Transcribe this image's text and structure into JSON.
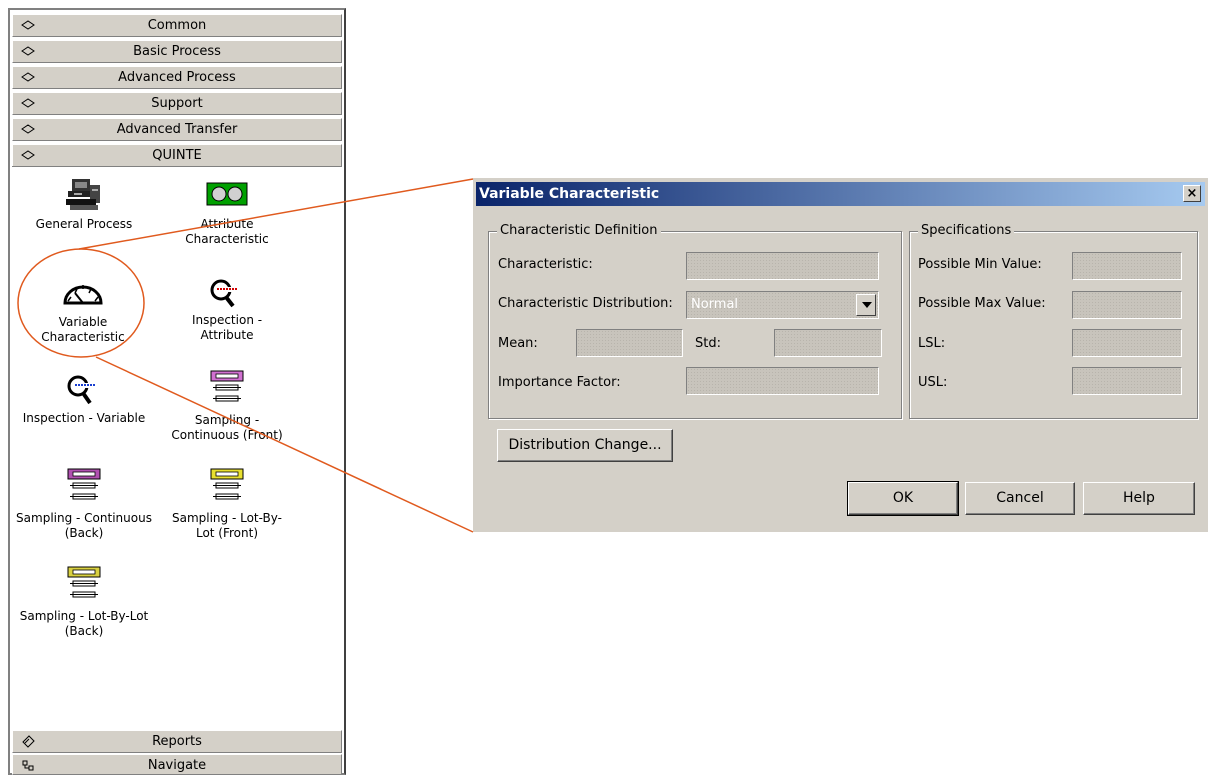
{
  "panel": {
    "top_categories": [
      {
        "label": "Common"
      },
      {
        "label": "Basic Process"
      },
      {
        "label": "Advanced Process"
      },
      {
        "label": "Support"
      },
      {
        "label": "Advanced Transfer"
      },
      {
        "label": "QUINTE"
      }
    ],
    "modules": [
      {
        "label": "General Process"
      },
      {
        "label": "Attribute Characteristic"
      },
      {
        "label": "Variable Characteristic"
      },
      {
        "label": "Inspection - Attribute"
      },
      {
        "label": "Inspection - Variable"
      },
      {
        "label": "Sampling - Continuous (Front)"
      },
      {
        "label": "Sampling - Continuous (Back)"
      },
      {
        "label": "Sampling - Lot-By-Lot (Front)"
      },
      {
        "label": "Sampling - Lot-By-Lot (Back)"
      }
    ],
    "bottom_categories": [
      {
        "label": "Reports"
      },
      {
        "label": "Navigate"
      }
    ]
  },
  "dialog": {
    "title": "Variable Characteristic",
    "close_glyph": "×",
    "definition_group": {
      "legend": "Characteristic Definition",
      "characteristic_label": "Characteristic:",
      "distribution_label": "Characteristic Distribution:",
      "distribution_value": "Normal",
      "mean_label": "Mean:",
      "std_label": "Std:",
      "importance_label": "Importance Factor:"
    },
    "spec_group": {
      "legend": "Specifications",
      "min_label": "Possible Min Value:",
      "max_label": "Possible Max Value:",
      "lsl_label": "LSL:",
      "usl_label": "USL:"
    },
    "distribution_change_button": "Distribution Change...",
    "ok_button": "OK",
    "cancel_button": "Cancel",
    "help_button": "Help"
  },
  "colors": {
    "title_gradient_start": "#0a246a",
    "title_gradient_end": "#a6caf0",
    "callout_line": "#e05a1e",
    "dialog_face": "#d4d0c8"
  },
  "icons": [
    "diamond-icon",
    "reports-icon",
    "navigate-icon",
    "computer-stack-icon",
    "traffic-light-icon",
    "gauge-icon",
    "magnifier-icon",
    "sampling-stack-icon",
    "close-icon",
    "dropdown-arrow-icon"
  ]
}
